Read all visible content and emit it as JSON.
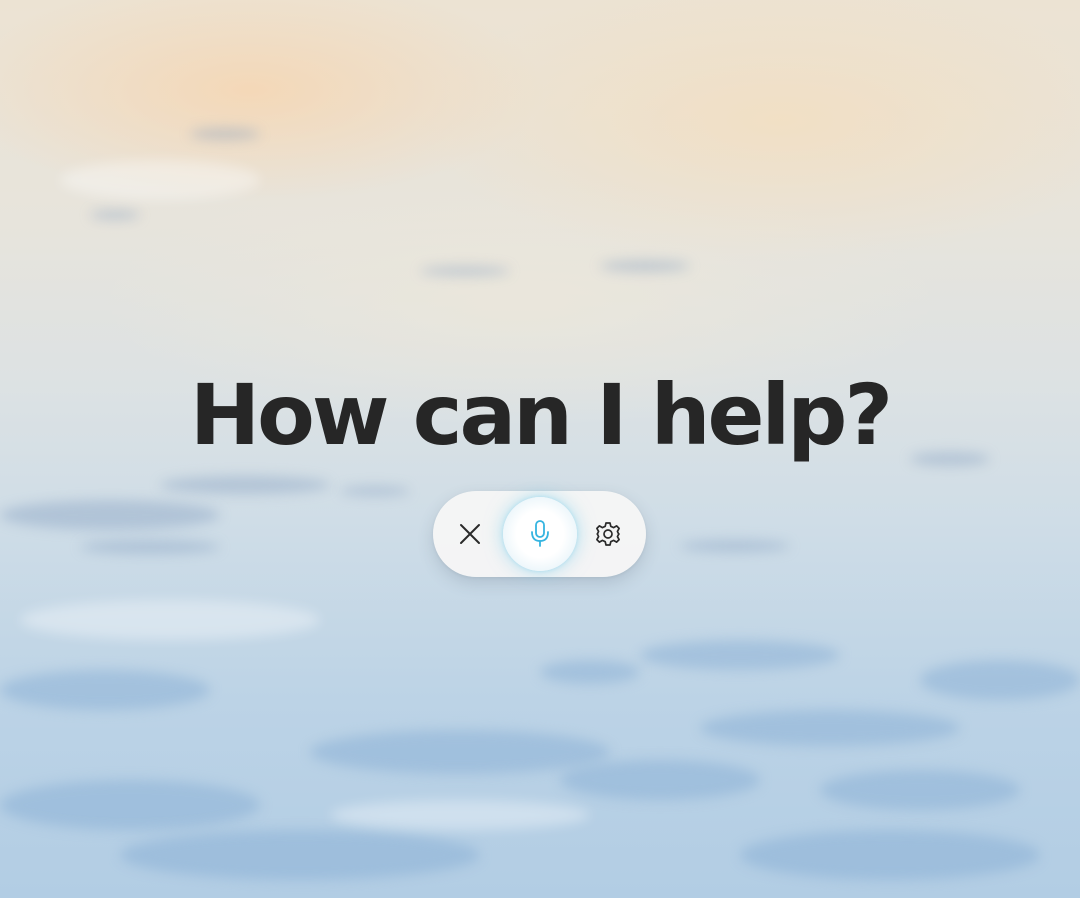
{
  "prompt": {
    "headline": "How can I help?"
  },
  "controls": {
    "close_icon": "close-icon",
    "mic_icon": "microphone-icon",
    "settings_icon": "gear-icon",
    "mic_state": "listening"
  },
  "colors": {
    "headline": "#262626",
    "mic_accent": "#35b4e0",
    "pill_background": "#f6f6f6"
  }
}
